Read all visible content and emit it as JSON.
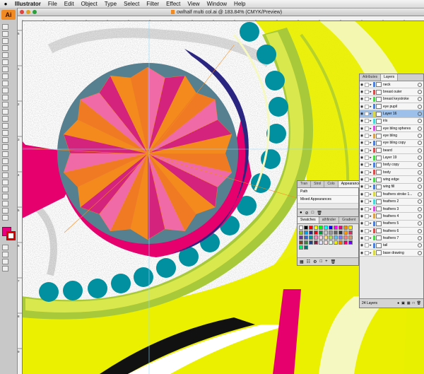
{
  "menubar": {
    "apple": "",
    "items": [
      "Illustrator",
      "File",
      "Edit",
      "Object",
      "Type",
      "Select",
      "Filter",
      "Effect",
      "View",
      "Window",
      "Help"
    ]
  },
  "document": {
    "title": "owlhalf multi col.ai @ 183.84% (CMYK/Preview)"
  },
  "toolbar": {
    "logo": "Ai"
  },
  "rulers": {
    "h_marks": [
      "240",
      "250",
      "260",
      "270",
      "280",
      "290",
      "300",
      "310",
      "320",
      "330",
      "340",
      "350",
      "360",
      "370",
      "380",
      "390",
      "400",
      "410",
      "420"
    ],
    "v_marks": [
      "5",
      "1",
      "2",
      "3",
      "4",
      "5",
      "6",
      "7",
      "8",
      "9"
    ]
  },
  "layers_panel": {
    "tabs": [
      "Attributes",
      "Layers"
    ],
    "active_tab": "Layers",
    "layers": [
      {
        "name": "neck",
        "color": "#4f7fd8"
      },
      {
        "name": "breast outer",
        "color": "#d84f4f"
      },
      {
        "name": "breast keystroke",
        "color": "#4fd84f"
      },
      {
        "name": "eye pupil",
        "color": "#4f7fd8"
      },
      {
        "name": "Layer 16",
        "color": "#d8d84f",
        "selected": true
      },
      {
        "name": "iris",
        "color": "#4fd8d8"
      },
      {
        "name": "eye bling spheres",
        "color": "#d84fd8"
      },
      {
        "name": "eye bling",
        "color": "#d8a04f"
      },
      {
        "name": "eye bling copy",
        "color": "#4f7fd8"
      },
      {
        "name": "beard",
        "color": "#d84f4f"
      },
      {
        "name": "Layer 19",
        "color": "#4fd84f"
      },
      {
        "name": "body copy",
        "color": "#4f7fd8"
      },
      {
        "name": "body",
        "color": "#d84f4f"
      },
      {
        "name": "wing edge",
        "color": "#4fd84f"
      },
      {
        "name": "wing fill",
        "color": "#4f7fd8"
      },
      {
        "name": "feathers stroke 1...",
        "color": "#d8d84f"
      },
      {
        "name": "feathers 2",
        "color": "#4fd8d8"
      },
      {
        "name": "feathers 3",
        "color": "#d84fd8"
      },
      {
        "name": "feathers 4",
        "color": "#d8a04f"
      },
      {
        "name": "feathers 5",
        "color": "#4f7fd8"
      },
      {
        "name": "feathers 6",
        "color": "#d84f4f"
      },
      {
        "name": "feathers 7",
        "color": "#4fd84f"
      },
      {
        "name": "tail",
        "color": "#4f7fd8"
      },
      {
        "name": "base drawing",
        "color": "#d8d84f"
      }
    ],
    "footer_count": "24 Layers"
  },
  "appearance_panel": {
    "tabs": [
      "Tran",
      "Strol",
      "Colo",
      "Appearance"
    ],
    "path_label": "Path",
    "mixed_label": "Mixed Appearances"
  },
  "swatches_panel": {
    "tabs": [
      "Swatches",
      "athfinder",
      "Gradient"
    ],
    "colors": [
      "#ffffff",
      "#000000",
      "#ff0000",
      "#ffff00",
      "#00ff00",
      "#00ffff",
      "#0000ff",
      "#ff00ff",
      "#e6007e",
      "#f39200",
      "#ffed00",
      "#95c11f",
      "#009fe3",
      "#312783",
      "#e30613",
      "#00963f",
      "#c8c8c8",
      "#999999",
      "#666666",
      "#333333",
      "#ff9900",
      "#cc3366",
      "#663399",
      "#3366cc",
      "#00a0a0",
      "#f08ac0",
      "#f5d0e0",
      "#ffe07a",
      "#b0e050",
      "#60c0f0",
      "#8080ff",
      "#ff8080",
      "#d0a070",
      "#804020",
      "#408040",
      "#204080",
      "#802040",
      "#e0e0ff",
      "#ffe0e0",
      "#e0ffe0",
      "#f0f000",
      "#f07000",
      "#f00070",
      "#7000f0",
      "#00f070",
      "#007070"
    ]
  }
}
